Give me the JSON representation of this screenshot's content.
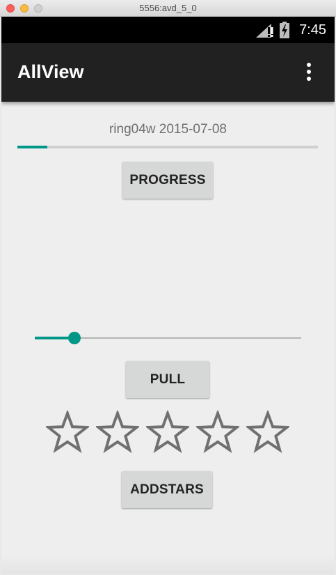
{
  "window": {
    "title": "5556:avd_5_0"
  },
  "status_bar": {
    "time": "7:45",
    "icons": [
      "signal-icon",
      "battery-charging-icon"
    ]
  },
  "app_bar": {
    "title": "AllView",
    "menu_icon": "overflow-menu-icon"
  },
  "content": {
    "date_text": "ring04w 2015-07-08",
    "progress": {
      "value_fraction": 0.1
    },
    "progress_button_label": "PROGRESS",
    "seekbar": {
      "value_fraction": 0.15
    },
    "pull_button_label": "PULL",
    "rating": {
      "max_stars": 5,
      "filled": 0
    },
    "addstars_button_label": "ADDSTARS"
  },
  "colors": {
    "accent": "#009688",
    "toolbar": "#212121",
    "background": "#eeeeee"
  }
}
